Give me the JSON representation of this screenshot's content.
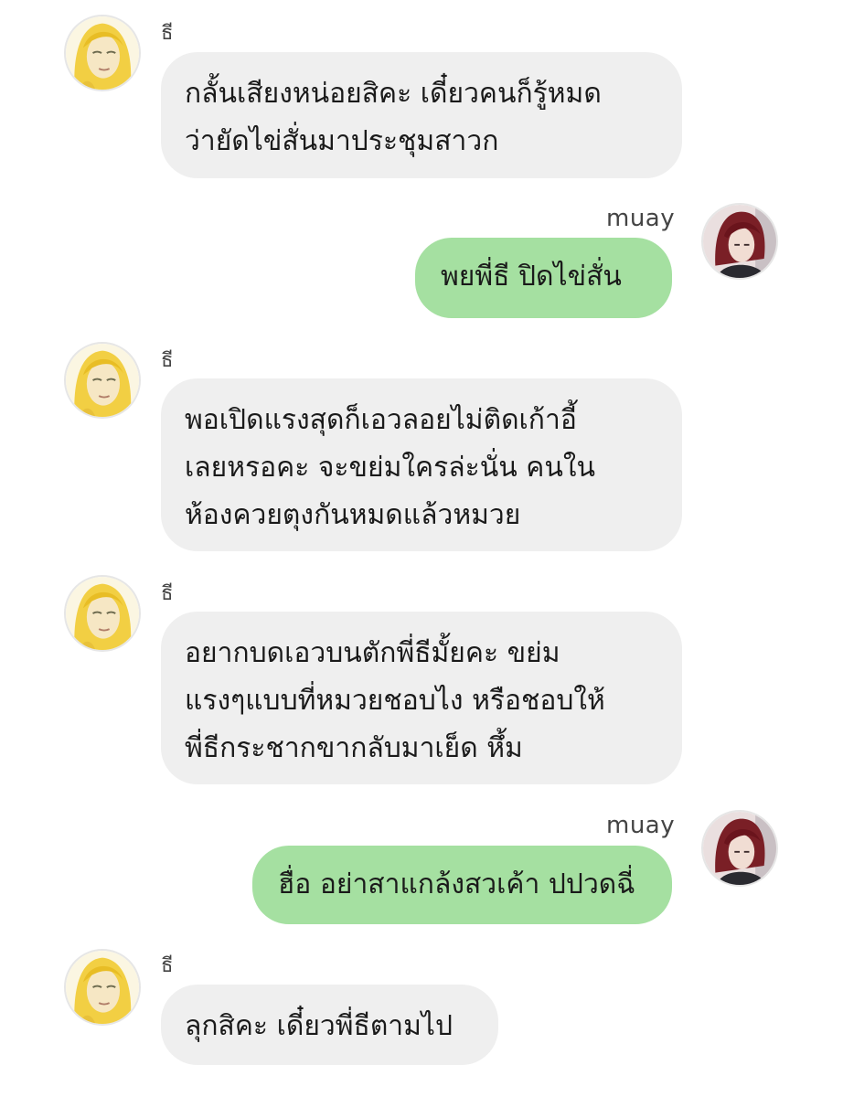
{
  "contacts": {
    "other": {
      "name": "ธี",
      "avatar_icon": "blonde-character-avatar-icon"
    },
    "me": {
      "name": "muay",
      "avatar_icon": "red-haired-character-avatar-icon"
    }
  },
  "colors": {
    "incoming_bubble": "#efefef",
    "outgoing_bubble": "#a5e0a1",
    "text": "#1a1a1a",
    "background": "#ffffff"
  },
  "messages": [
    {
      "from": "ธี",
      "lines": [
        "กลั้นเสียงหน่อยสิคะ เดี๋ยวคนก็รู้หมด",
        "ว่ายัดไข่สั่นมาประชุมสาวก"
      ]
    },
    {
      "from": "muay",
      "lines": [
        "พยพี่ธี ปิดไข่สั่น"
      ]
    },
    {
      "from": "ธี",
      "lines": [
        "พอเปิดแรงสุดก็เอวลอยไม่ติดเก้าอี้",
        "เลยหรอคะ จะขย่มใครล่ะนั่น คนใน",
        "ห้องควยตุงกันหมดแล้วหมวย"
      ]
    },
    {
      "from": "ธี",
      "lines": [
        "อยากบดเอวบนตักพี่ธีมั้ยคะ ขย่ม",
        "แรงๆแบบที่หมวยชอบไง หรือชอบให้",
        "พี่ธีกระชากขากลับมาเย็ด หึ้ม"
      ]
    },
    {
      "from": "muay",
      "lines": [
        "ฮื่อ อย่าสาแกล้งสวเค้า ปปวดฉี่"
      ]
    },
    {
      "from": "ธี",
      "lines": [
        "ลุกสิคะ เดี๋ยวพี่ธีตามไป"
      ]
    }
  ]
}
